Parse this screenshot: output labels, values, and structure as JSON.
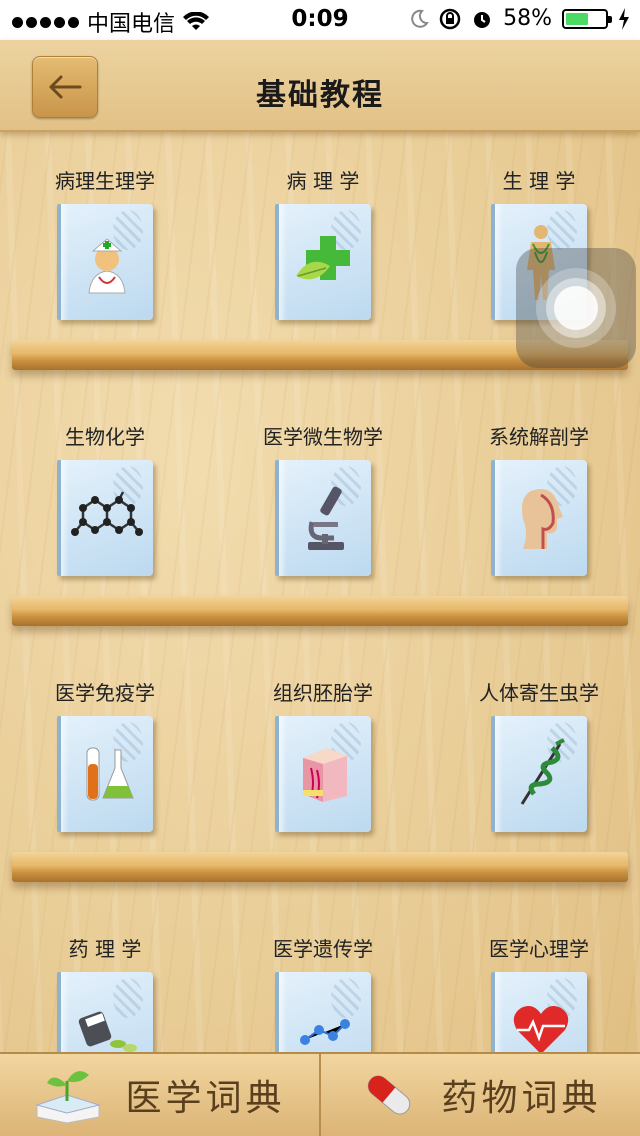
{
  "status_bar": {
    "carrier": "中国电信",
    "time": "0:09",
    "battery": "58%",
    "battery_level": 0.58
  },
  "navbar": {
    "title": "基础教程",
    "back_icon": "←"
  },
  "books": [
    {
      "label": "病理生理学",
      "icon": "nurse-icon"
    },
    {
      "label": "病 理 学",
      "icon": "leaf-cross-icon"
    },
    {
      "label": "生 理 学",
      "icon": "human-body-icon"
    },
    {
      "label": "生物化学",
      "icon": "molecule-icon"
    },
    {
      "label": "医学微生物学",
      "icon": "microscope-icon"
    },
    {
      "label": "系统解剖学",
      "icon": "head-anatomy-icon"
    },
    {
      "label": "医学免疫学",
      "icon": "test-tube-icon"
    },
    {
      "label": "组织胚胎学",
      "icon": "tissue-icon"
    },
    {
      "label": "人体寄生虫学",
      "icon": "caduceus-icon"
    },
    {
      "label": "药 理 学",
      "icon": "pill-bottle-icon"
    },
    {
      "label": "医学遗传学",
      "icon": "dna-molecule-icon"
    },
    {
      "label": "医学心理学",
      "icon": "heart-icon"
    }
  ],
  "tabbar": {
    "tabs": [
      {
        "label": "医学词典",
        "icon": "book-sprout-icon"
      },
      {
        "label": "药物词典",
        "icon": "capsule-icon"
      }
    ]
  },
  "colors": {
    "wood_light": "#efd6a6",
    "shelf": "#d9a556",
    "book_cover": "#cfe4f5",
    "text": "#222222"
  }
}
